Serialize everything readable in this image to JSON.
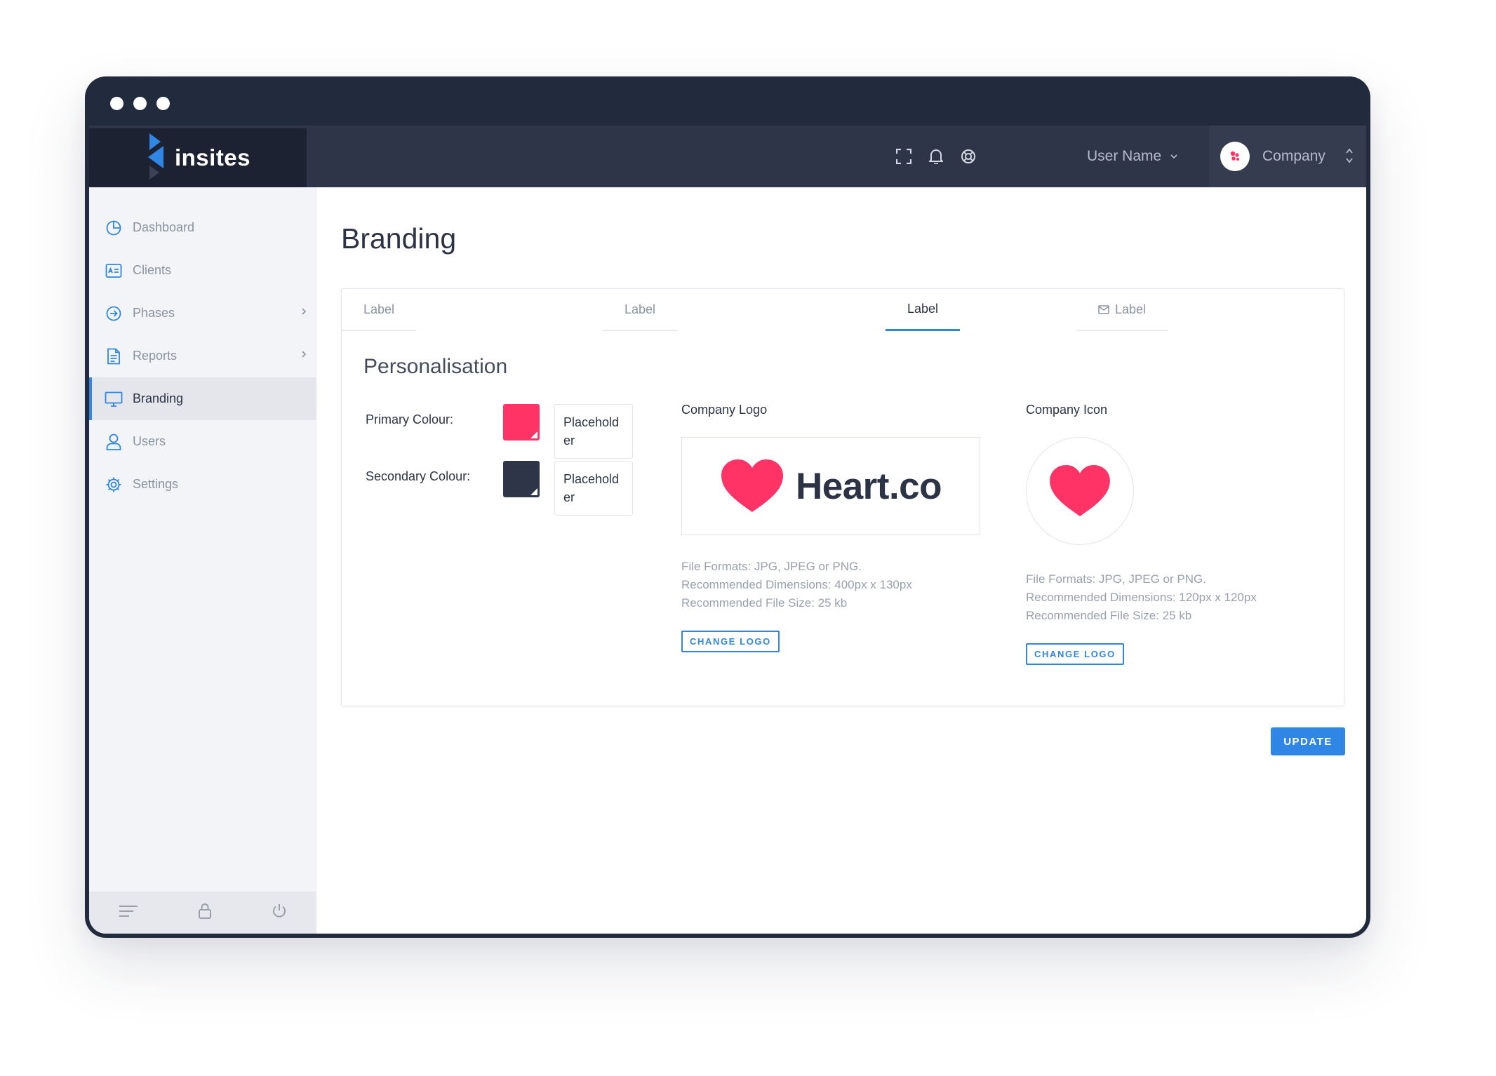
{
  "app": {
    "brand_name": "insites",
    "brand_color": "#2f86e4"
  },
  "header": {
    "icons": [
      "fullscreen-icon",
      "bell-icon",
      "help-icon"
    ],
    "user_name": "User Name",
    "company_name": "Company"
  },
  "sidebar": {
    "items": [
      {
        "label": "Dashboard",
        "icon": "pie-chart-icon",
        "active": false,
        "has_submenu": false
      },
      {
        "label": "Clients",
        "icon": "id-card-icon",
        "active": false,
        "has_submenu": false
      },
      {
        "label": "Phases",
        "icon": "arrow-circle-icon",
        "active": false,
        "has_submenu": true
      },
      {
        "label": "Reports",
        "icon": "document-icon",
        "active": false,
        "has_submenu": true
      },
      {
        "label": "Branding",
        "icon": "monitor-icon",
        "active": true,
        "has_submenu": false
      },
      {
        "label": "Users",
        "icon": "user-icon",
        "active": false,
        "has_submenu": false
      },
      {
        "label": "Settings",
        "icon": "gear-icon",
        "active": false,
        "has_submenu": false
      }
    ],
    "footer_icons": [
      "menu-lines-icon",
      "lock-icon",
      "power-icon"
    ]
  },
  "main": {
    "title": "Branding",
    "tabs": [
      {
        "label": "Label",
        "active": false
      },
      {
        "label": "Label",
        "active": false
      },
      {
        "label": "Label",
        "active": true
      },
      {
        "label": "Label",
        "active": false,
        "icon": "mail-icon"
      }
    ],
    "section_title": "Personalisation",
    "colors": {
      "primary_label": "Primary Colour:",
      "primary_value": "#ff3366",
      "primary_placeholder": "Placeholder",
      "secondary_label": "Secondary Colour:",
      "secondary_value": "#2e3548",
      "secondary_placeholder": "Placeholder"
    },
    "company_logo": {
      "label": "Company Logo",
      "logo_text": "Heart.co",
      "info_formats": "File Formats: JPG, JPEG or PNG.",
      "info_dimensions": "Recommended Dimensions: 400px x 130px",
      "info_size": "Recommended File Size: 25 kb",
      "button": "CHANGE LOGO"
    },
    "company_icon": {
      "label": "Company Icon",
      "info_formats": "File Formats: JPG, JPEG or PNG.",
      "info_dimensions": "Recommended Dimensions: 120px x 120px",
      "info_size": "Recommended File Size: 25 kb",
      "button": "CHANGE LOGO"
    },
    "update_button": "UPDATE"
  }
}
